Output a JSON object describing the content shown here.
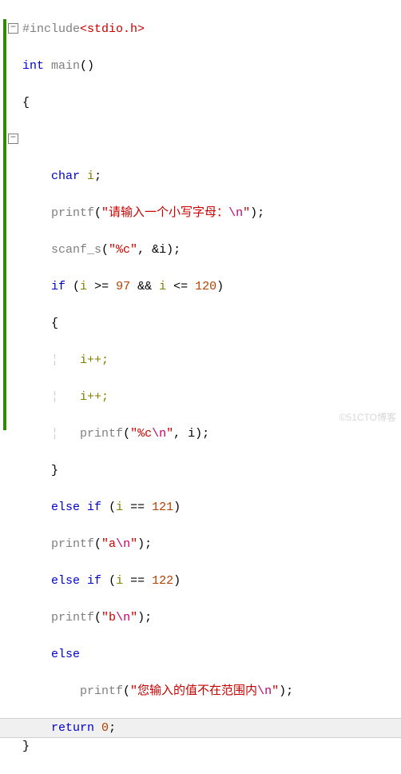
{
  "code": {
    "pp_include": "#include",
    "header": "<stdio.h>",
    "kw_int": "int",
    "fn_main": "main",
    "parens": "()",
    "lbrace": "{",
    "rbrace": "}",
    "kw_char": "char",
    "var_i": "i",
    "semi": ";",
    "fn_printf": "printf",
    "str_prompt_a": "\"请输入一个小写字母：",
    "esc_n": "\\n",
    "str_prompt_b": "\"",
    "close_paren_semi": ");",
    "fn_scanf": "scanf_s",
    "str_fmt_c_a": "\"%c\"",
    "comma_sp": ", ",
    "amp_i": "&i",
    "kw_if": "if",
    "sp_open": " (",
    "cmp_ge": " >= ",
    "num_97": "97",
    "and": " && ",
    "cmp_le": " <= ",
    "num_120": "120",
    "close_p": ")",
    "ipp": "i++;",
    "str_fmt_cn_a": "\"%c",
    "str_fmt_cn_b": "\"",
    "comma_i": ", i);",
    "kw_else": "else",
    "cmp_eq": " == ",
    "num_121": "121",
    "str_a_a": "\"a",
    "str_a_b": "\"",
    "num_122": "122",
    "str_b_a": "\"b",
    "str_b_b": "\"",
    "str_err_a": "\"您输入的值不在范围内",
    "str_err_b": "\"",
    "kw_return": "return",
    "num_0": "0"
  },
  "watermark": "©51CTO博客"
}
